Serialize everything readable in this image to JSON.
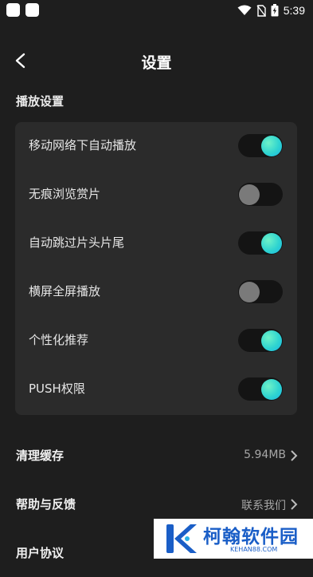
{
  "status_bar": {
    "time": "5:39",
    "icons": [
      "app-square-icon",
      "app-square-icon",
      "wifi-icon",
      "no-sim-icon",
      "battery-charging-icon"
    ]
  },
  "header": {
    "title": "设置",
    "back_icon": "back-arrow-icon"
  },
  "playback_section": {
    "title": "播放设置",
    "items": [
      {
        "label": "移动网络下自动播放",
        "on": true
      },
      {
        "label": "无痕浏览赏片",
        "on": false
      },
      {
        "label": "自动跳过片头片尾",
        "on": true
      },
      {
        "label": "横屏全屏播放",
        "on": false
      },
      {
        "label": "个性化推荐",
        "on": true
      },
      {
        "label": "PUSH权限",
        "on": true
      }
    ]
  },
  "list": [
    {
      "label": "清理缓存",
      "value": "5.94MB"
    },
    {
      "label": "帮助与反馈",
      "value": "联系我们"
    },
    {
      "label": "用户协议",
      "value": ""
    }
  ],
  "watermark": {
    "title": "柯翰软件园",
    "subtitle": "KEHAN88.COM"
  },
  "colors": {
    "background": "#1e1e1e",
    "card": "#2b2b2b",
    "toggle_on_knob": "#2fd4d0",
    "toggle_off_knob": "#7a7a7a",
    "watermark_blue": "#1a5ec7"
  }
}
